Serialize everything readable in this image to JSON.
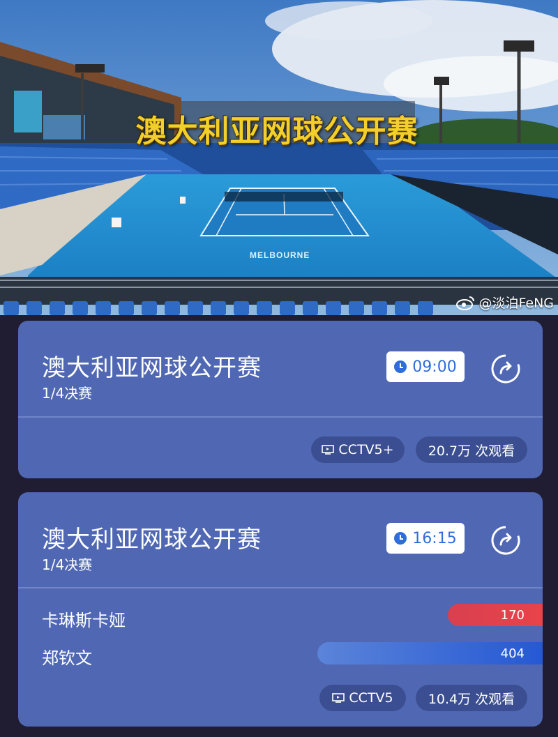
{
  "banner": {
    "title": "澳大利亚网球公开赛",
    "court_text": "MELBOURNE",
    "watermark": "@淡泊FeNG"
  },
  "matches": [
    {
      "title": "澳大利亚网球公开赛",
      "round": "1/4决赛",
      "time": "09:00",
      "channel": "CCTV5+",
      "views": "20.7万  次观看"
    },
    {
      "title": "澳大利亚网球公开赛",
      "round": "1/4决赛",
      "time": "16:15",
      "channel": "CCTV5",
      "views": "10.4万  次观看",
      "players": [
        {
          "name": "卡琳斯卡娅",
          "votes": "170",
          "share": 0.1806
        },
        {
          "name": "郑钦文",
          "votes": "404",
          "share": 0.4293
        }
      ]
    }
  ],
  "colors": {
    "card_bg": "#5068b3",
    "page_bg": "#201d33",
    "pill_bg": "#3b4e91",
    "time_text": "#2f6ddc",
    "bar_red": "#e8434a",
    "bar_blue": "#2558d4",
    "title_gold": "#f2cf2a"
  },
  "icons": {
    "time": "clock-icon",
    "replay": "replay-icon",
    "channel": "tv-icon",
    "watermark": "weibo-logo-icon"
  }
}
